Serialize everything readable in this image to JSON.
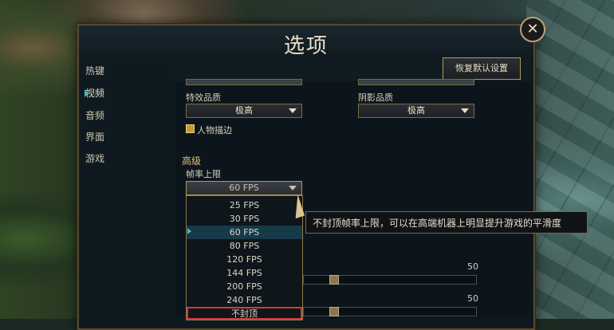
{
  "dialog": {
    "title": "选项",
    "close_symbol": "✕",
    "reset_label": "恢复默认设置"
  },
  "sidebar": {
    "items": [
      {
        "label": "热键"
      },
      {
        "label": "视频",
        "active": true
      },
      {
        "label": "音频"
      },
      {
        "label": "界面"
      },
      {
        "label": "游戏"
      }
    ]
  },
  "video": {
    "effects_quality_label": "特效品质",
    "effects_quality_value": "极高",
    "shadow_quality_label": "阴影品质",
    "shadow_quality_value": "极高",
    "character_outline_label": "人物描边",
    "advanced_title": "高级",
    "frame_rate_label": "帧率上限",
    "frame_rate_value": "60 FPS",
    "frame_rate_options": [
      "25 FPS",
      "30 FPS",
      "60 FPS",
      "80 FPS",
      "120 FPS",
      "144 FPS",
      "200 FPS",
      "240 FPS",
      "不封顶"
    ],
    "tooltip": "不封顶帧率上限，可以在高端机器上明显提升游戏的平滑度",
    "slider_values": [
      "50",
      "50"
    ],
    "slider_fractions": [
      0.5,
      0.5
    ]
  },
  "icons": {
    "close": "close-icon",
    "dropdown": "chevron-down-icon",
    "sidebar_marker": "triangle-right-icon",
    "cursor": "mouse-pointer-icon"
  },
  "colors": {
    "accent": "#b39a5b",
    "title": "#e9dfc5",
    "selected": "#163a48",
    "highlight": "#d43a3a"
  }
}
